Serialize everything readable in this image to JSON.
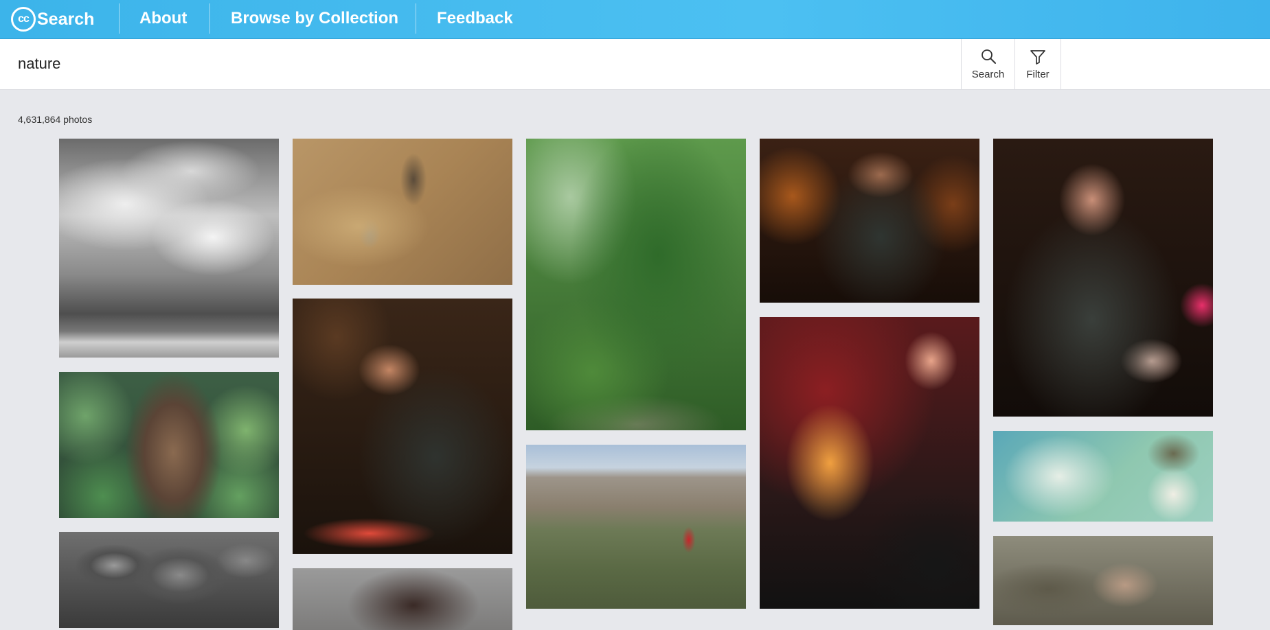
{
  "nav": {
    "logo_mark": "cc",
    "logo_text": "Search",
    "links": [
      "About",
      "Browse by Collection",
      "Feedback"
    ]
  },
  "search": {
    "query": "nature",
    "search_label": "Search",
    "filter_label": "Filter",
    "icons": [
      "magnifier-icon",
      "funnel-icon"
    ]
  },
  "results": {
    "count_label": "4,631,864 photos",
    "photos": [
      {
        "subject": "storm-clouds-over-beach"
      },
      {
        "subject": "ivy-and-tree-stump"
      },
      {
        "subject": "mushrooms-black-and-white"
      },
      {
        "subject": "branch-lantern-on-wall"
      },
      {
        "subject": "dj-with-headphones"
      },
      {
        "subject": "dried-flower-stems"
      },
      {
        "subject": "green-tree-canopy"
      },
      {
        "subject": "person-and-dog-in-field"
      },
      {
        "subject": "dj-at-turntable"
      },
      {
        "subject": "dj-at-mixer-red-lights"
      },
      {
        "subject": "dj-on-phone-headphones"
      },
      {
        "subject": "magazine-mountain-layout"
      },
      {
        "subject": "man-in-forest"
      }
    ]
  }
}
